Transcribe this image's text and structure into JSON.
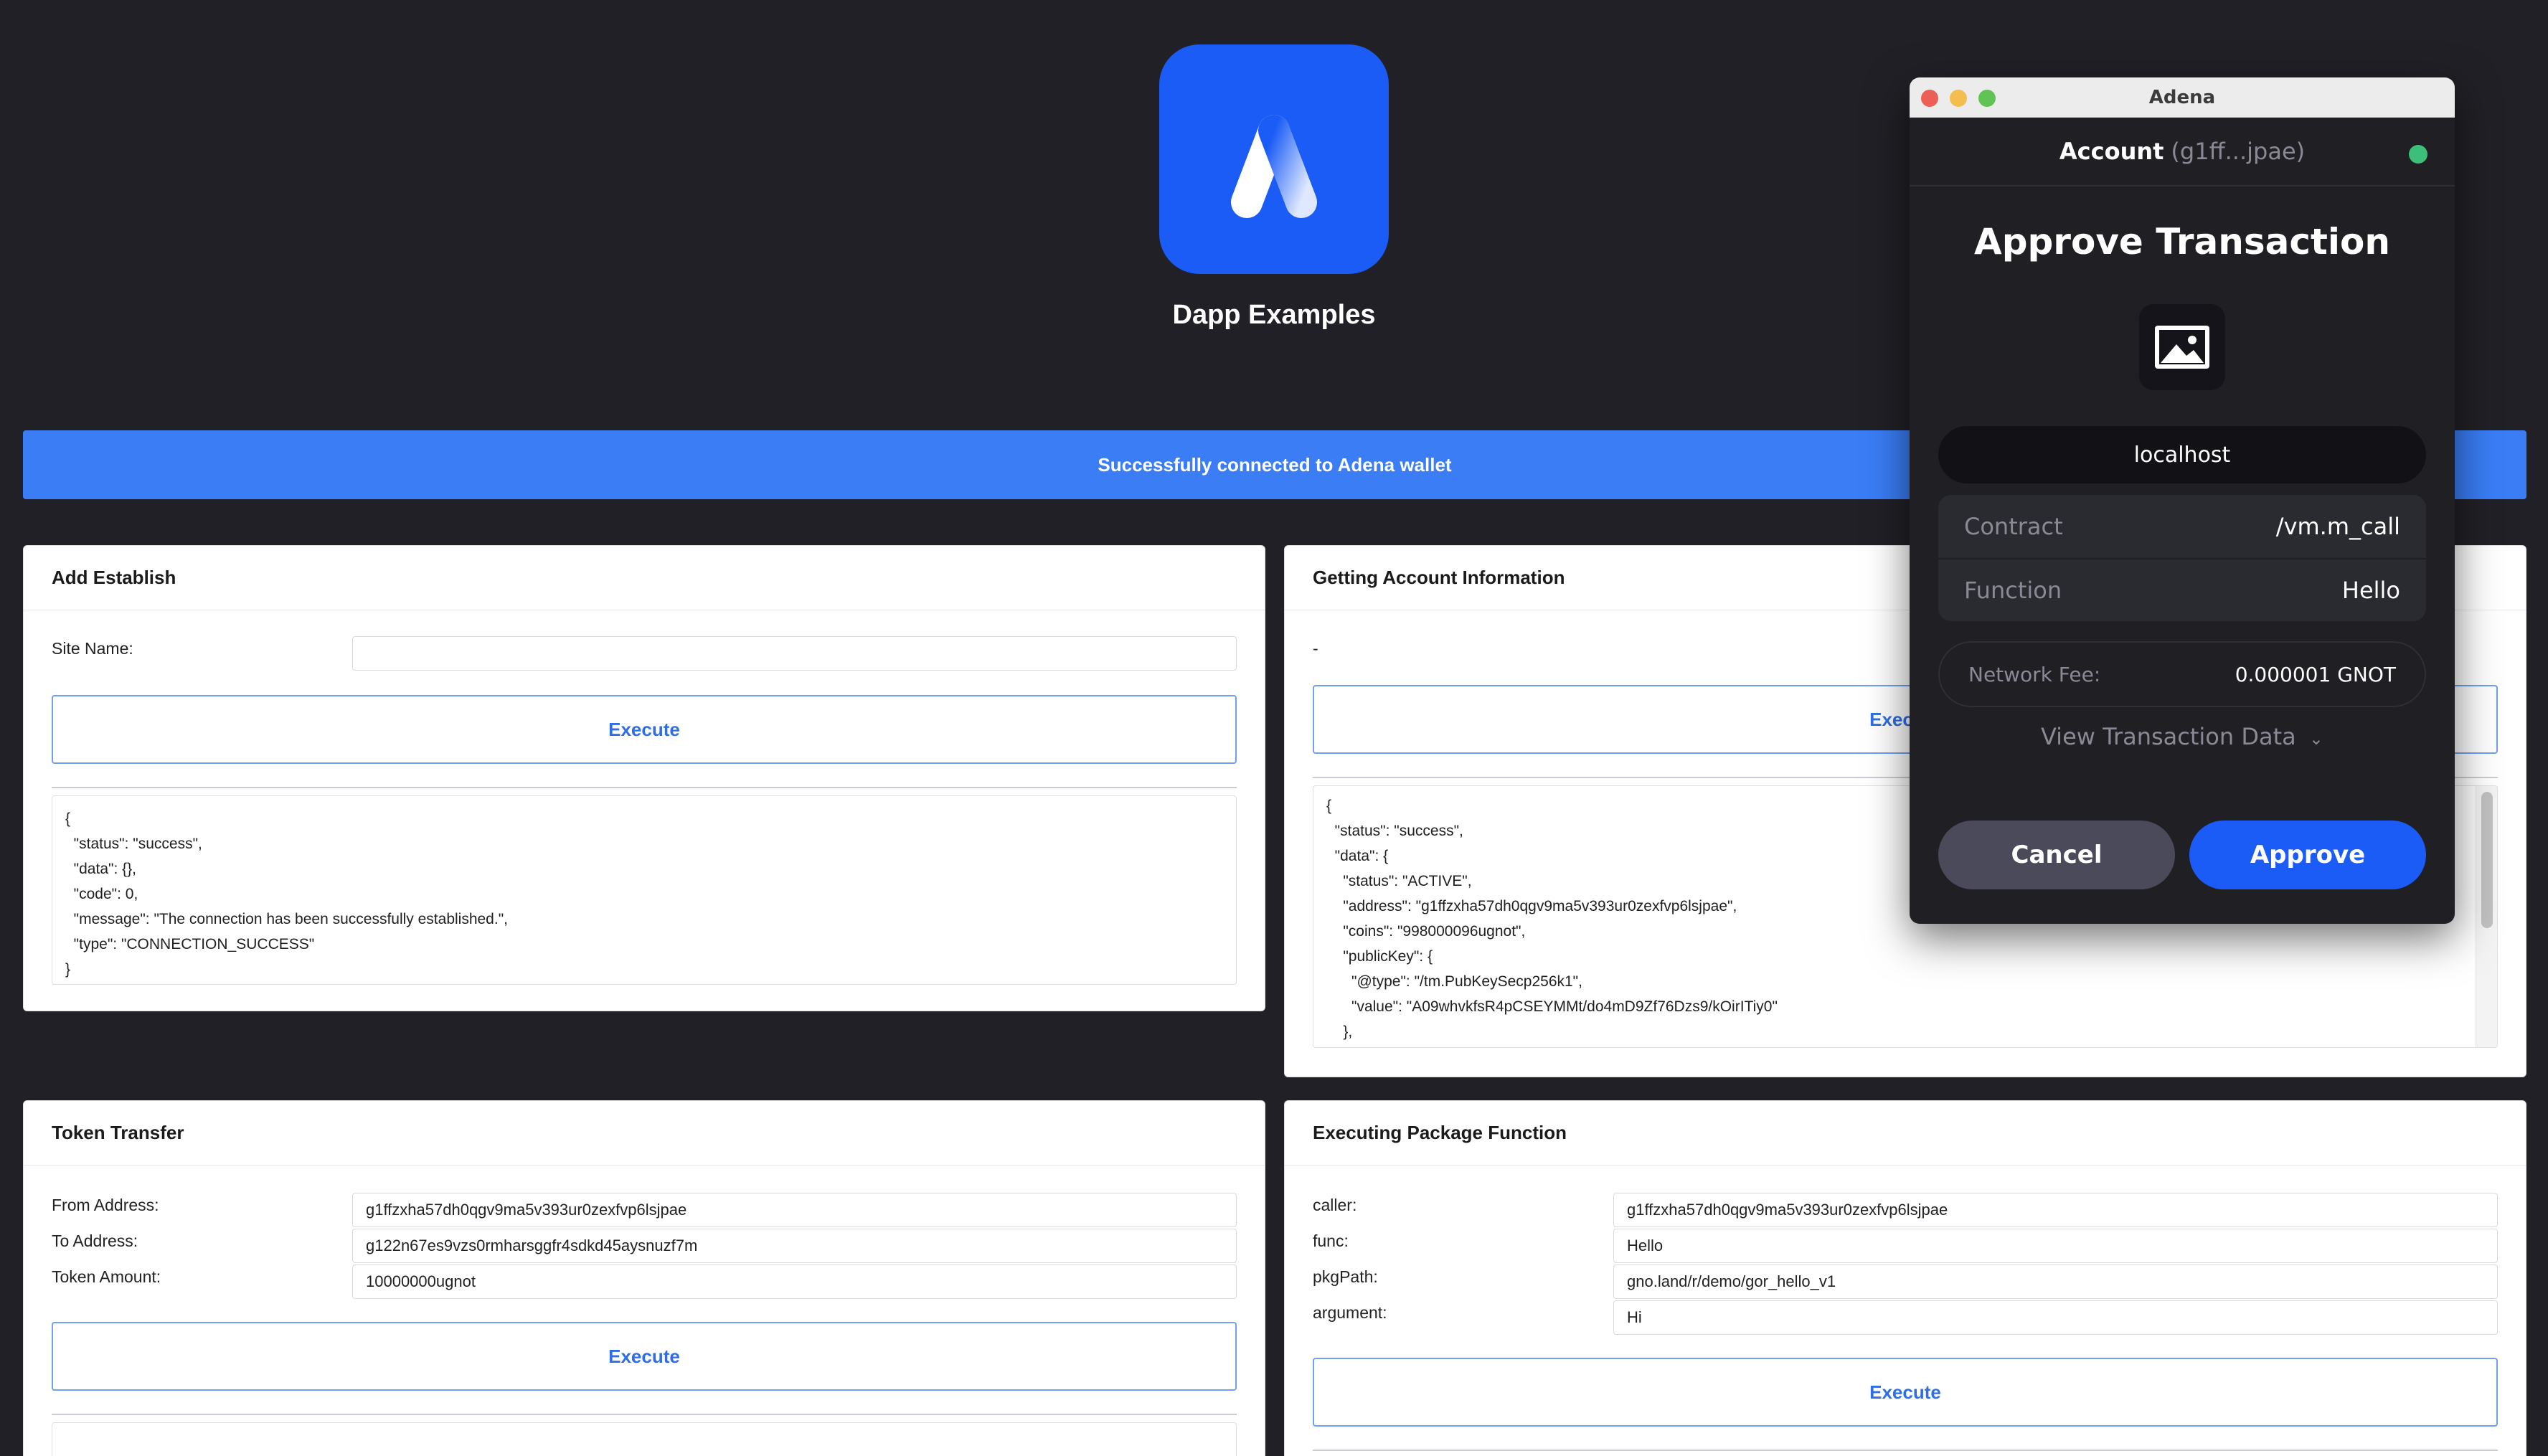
{
  "app": {
    "title": "Dapp Examples",
    "logo_icon": "adena-logo-icon",
    "brand_color": "#1a5cf5"
  },
  "banner": {
    "text": "Successfully connected to Adena wallet",
    "color": "#3a7df5"
  },
  "add_establish": {
    "title": "Add Establish",
    "site_name_label": "Site Name:",
    "site_name_value": "",
    "execute_label": "Execute",
    "result_lines": [
      "{",
      "  \"status\": \"success\",",
      "  \"data\": {},",
      "  \"code\": 0,",
      "  \"message\": \"The connection has been successfully established.\",",
      "  \"type\": \"CONNECTION_SUCCESS\"",
      "}"
    ]
  },
  "account_info": {
    "title": "Getting Account Information",
    "dash": "-",
    "execute_label": "Execute",
    "result_lines": [
      "{",
      "  \"status\": \"success\",",
      "  \"data\": {",
      "    \"status\": \"ACTIVE\",",
      "    \"address\": \"g1ffzxha57dh0qgv9ma5v393ur0zexfvp6lsjpae\",",
      "    \"coins\": \"998000096ugnot\",",
      "    \"publicKey\": {",
      "      \"@type\": \"/tm.PubKeySecp256k1\",",
      "      \"value\": \"A09whvkfsR4pCSEYMMt/do4mD9Zf76Dzs9/kOirITiy0\"",
      "    },"
    ]
  },
  "token_transfer": {
    "title": "Token Transfer",
    "from_label": "From Address:",
    "from_value": "g1ffzxha57dh0qgv9ma5v393ur0zexfvp6lsjpae",
    "to_label": "To Address:",
    "to_value": "g122n67es9vzs0rmharsggfr4sdkd45aysnuzf7m",
    "amount_label": "Token Amount:",
    "amount_value": "10000000ugnot",
    "execute_label": "Execute"
  },
  "package_function": {
    "title": "Executing Package Function",
    "caller_label": "caller:",
    "caller_value": "g1ffzxha57dh0qgv9ma5v393ur0zexfvp6lsjpae",
    "func_label": "func:",
    "func_value": "Hello",
    "pkgpath_label": "pkgPath:",
    "pkgpath_value": "gno.land/r/demo/gor_hello_v1",
    "argument_label": "argument:",
    "argument_value": "Hi",
    "execute_label": "Execute"
  },
  "wallet": {
    "window_title": "Adena",
    "account_label": "Account",
    "account_address": "(g1ff...jpae)",
    "status_color": "#3dbf7a",
    "heading": "Approve Transaction",
    "image_icon": "image-placeholder-icon",
    "domain": "localhost",
    "contract_label": "Contract",
    "contract_value": "/vm.m_call",
    "function_label": "Function",
    "function_value": "Hello",
    "fee_label": "Network Fee:",
    "fee_value": "0.000001 GNOT",
    "view_data_label": "View Transaction Data",
    "cancel_label": "Cancel",
    "approve_label": "Approve",
    "approve_color": "#1a5cf5",
    "cancel_color": "#4a4a5a"
  }
}
